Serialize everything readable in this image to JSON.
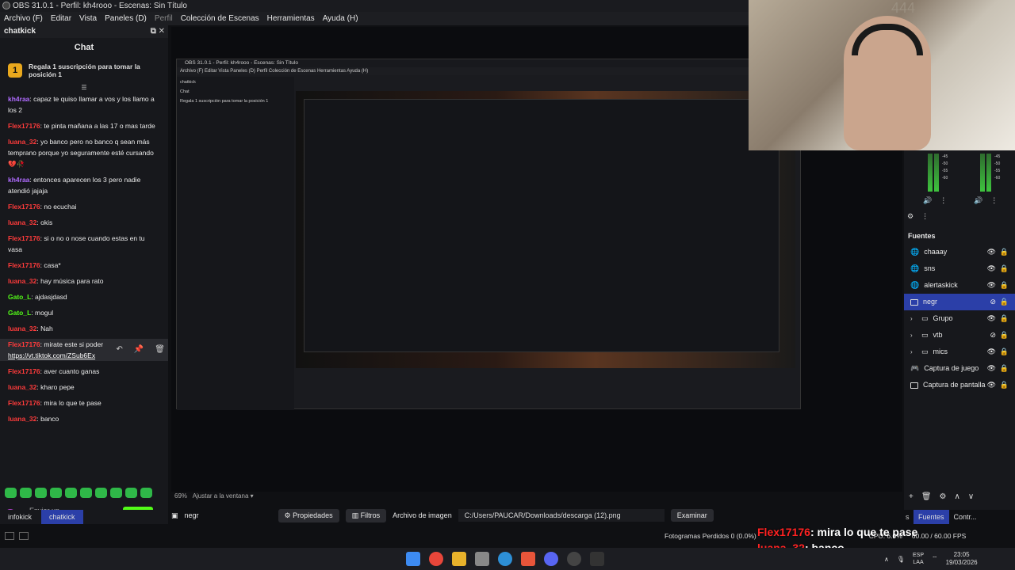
{
  "window": {
    "title": "OBS 31.0.1 - Perfil: kh4rooo - Escenas: Sin Título"
  },
  "menu": [
    "Archivo (F)",
    "Editar",
    "Vista",
    "Paneles (D)",
    "Perfil",
    "Colección de Escenas",
    "Herramientas",
    "Ayuda (H)"
  ],
  "chat_dock": {
    "dock_title": "chatkick",
    "panel_title": "Chat",
    "gift_text": "Regala 1 suscripción para tomar la posición 1",
    "gift_rank": "1",
    "messages": [
      {
        "user": "kh4raa",
        "text": ": capaz te quiso llamar a vos y los llamo a los 2",
        "color": "#b06cff"
      },
      {
        "user": "Flex17176",
        "text": ": te pinta mañana a las 17 o mas tarde",
        "color": "#ff3b3b"
      },
      {
        "user": "luana_32",
        "text": ": yo banco pero no banco q sean más temprano porque yo seguramente esté cursando 💔🥀",
        "color": "#ff3b3b"
      },
      {
        "user": "kh4raa",
        "text": ": entonces aparecen los 3 pero nadie atendió jajaja",
        "color": "#b06cff"
      },
      {
        "user": "Flex17176",
        "text": ": no ecuchai",
        "color": "#ff3b3b"
      },
      {
        "user": "luana_32",
        "text": ": okis",
        "color": "#ff3b3b"
      },
      {
        "user": "Flex17176",
        "text": ": si o no o nose cuando estas en tu vasa",
        "color": "#ff3b3b"
      },
      {
        "user": "Flex17176",
        "text": ": casa*",
        "color": "#ff3b3b"
      },
      {
        "user": "luana_32",
        "text": ": hay música para rato",
        "color": "#ff3b3b"
      },
      {
        "user": "Gato_L",
        "text": ": ajdasjdasd",
        "color": "#53fc18"
      },
      {
        "user": "Gato_L",
        "text": ": mogul",
        "color": "#53fc18"
      },
      {
        "user": "luana_32",
        "text": ": Nah",
        "color": "#ff3b3b"
      }
    ],
    "hover_message": {
      "user": "Flex17176",
      "text": ": mirate este si poder",
      "link": "https://vt.tiktok.com/ZSub6Ex",
      "color": "#ff3b3b"
    },
    "messages_after": [
      {
        "user": "Flex17176",
        "text": ": aver cuanto ganas",
        "color": "#ff3b3b"
      },
      {
        "user": "luana_32",
        "text": ": kharo pepe",
        "color": "#ff3b3b"
      },
      {
        "user": "Flex17176",
        "text": ": mira lo que te pase",
        "color": "#ff3b3b"
      },
      {
        "user": "luana_32",
        "text": ": banco",
        "color": "#ff3b3b"
      }
    ],
    "input_placeholder": "Enviar un mensaje",
    "send_label": "Chat",
    "tabs": [
      "infokick",
      "chatkick"
    ]
  },
  "preview": {
    "nested_title": "OBS 31.0.1 - Perfil: kh4rooo - Escenas: Sin Título",
    "nested_menu": "Archivo (F)   Editar   Vista   Paneles (D)   Perfil   Colección de Escenas   Herramientas   Ayuda (H)",
    "nested_dock": "chatkick",
    "zoom": "69%",
    "zoom_fit": "Ajustar a la ventana"
  },
  "sources": {
    "title": "Fuentes",
    "items": [
      {
        "name": "chaaay",
        "icon": "globe-icon",
        "indent": false,
        "selected": false
      },
      {
        "name": "sns",
        "icon": "globe-icon",
        "indent": false,
        "selected": false
      },
      {
        "name": "alertaskick",
        "icon": "globe-icon",
        "indent": false,
        "selected": false
      },
      {
        "name": "negr",
        "icon": "image-icon",
        "indent": false,
        "selected": true
      },
      {
        "name": "Grupo",
        "icon": "folder-icon",
        "indent": true,
        "selected": false
      },
      {
        "name": "vtb",
        "icon": "folder-icon",
        "indent": true,
        "selected": false
      },
      {
        "name": "mics",
        "icon": "folder-icon",
        "indent": true,
        "selected": false
      },
      {
        "name": "Captura de juego",
        "icon": "gamepad-icon",
        "indent": false,
        "selected": false
      },
      {
        "name": "Captura de pantalla",
        "icon": "monitor-icon",
        "indent": false,
        "selected": false
      }
    ],
    "tabs": [
      "s",
      "Fuentes",
      "Contr..."
    ],
    "meter_labels": [
      "-45",
      "-50",
      "-55",
      "-60"
    ]
  },
  "source_bar": {
    "name": "negr",
    "properties": "Propiedades",
    "filters": "Filtros",
    "image_file": "Archivo de imagen",
    "path": "C:/Users/PAUCAR/Downloads/descarga (12).png",
    "browse": "Examinar"
  },
  "status": {
    "dropped": "Fotogramas Perdidos 0 (0.0%)",
    "cpu": "CPU: 6.0%",
    "fps": "60.00 / 60.00 FPS"
  },
  "overlay": [
    {
      "user": "Flex17176",
      "text": ": mira lo que te pase"
    },
    {
      "user": "luana_32",
      "text": ": banco"
    }
  ],
  "taskbar": {
    "time": "23:05",
    "date": "19/03/2026",
    "lang1": "ESP",
    "lang2": "LAA"
  },
  "colors": {
    "accent": "#2b3fa8",
    "kick_green": "#53fc18",
    "user_red": "#ff3b3b"
  }
}
